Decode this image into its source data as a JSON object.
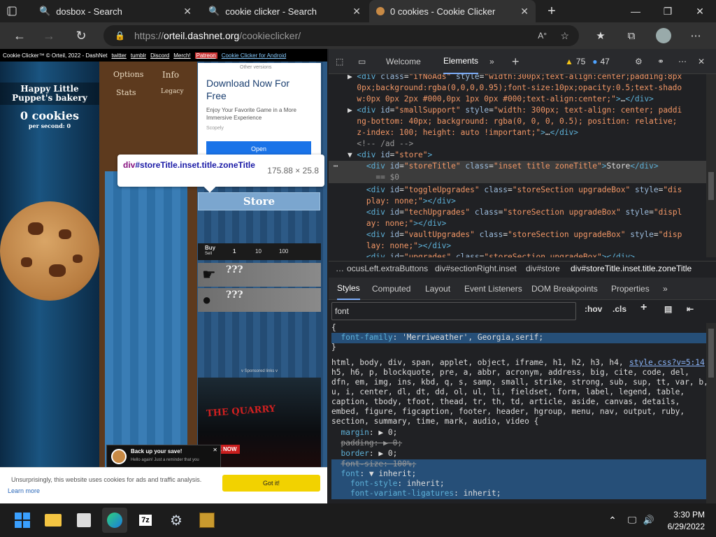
{
  "tabs": [
    {
      "title": "dosbox - Search",
      "icon": "search-icon"
    },
    {
      "title": "cookie clicker - Search",
      "icon": "search-icon"
    },
    {
      "title": "0 cookies - Cookie Clicker",
      "icon": "cookie-icon"
    }
  ],
  "address": {
    "scheme": "https://",
    "host": "orteil.dashnet.org",
    "path": "/cookieclicker/"
  },
  "site": {
    "topbar": [
      "Cookie Clicker™ © Orteil, 2022 - DashNet",
      "twitter",
      "tumblr",
      "Discord",
      "Merch!",
      "Patreon",
      "Cookie Clicker for Android"
    ],
    "bakery_name": "Happy Little Puppet's bakery",
    "cookies": "0 cookies",
    "per_second": "per second: 0",
    "buttons": {
      "options": "Options",
      "info": "Info",
      "stats": "Stats",
      "legacy": "Legacy"
    },
    "ad1": {
      "other": "Other versions",
      "title": "Download Now For Free",
      "desc": "Enjoy Your Favorite Game in a More Immersive Experience",
      "source": "Scopely",
      "open": "Open"
    },
    "tooltip": {
      "selector_tag": "div",
      "selector_rest": "#storeTitle.inset.title.zoneTitle",
      "size": "175.88 × 25.8"
    },
    "store": "Store",
    "buy": {
      "buy": "Buy",
      "sell": "Sell",
      "opts": [
        "1",
        "10",
        "100"
      ]
    },
    "product": "???",
    "sponsored": "v Sponsored links v",
    "ad2": {
      "title": "THE QUARRY",
      "cta": "ABLE NOW"
    },
    "backup": {
      "title": "Back up your save!",
      "text": "Hello again! Just a reminder that you"
    },
    "cookie_notice": {
      "message": "Unsurprisingly, this website uses cookies for ads and traffic analysis.",
      "learn": "Learn more",
      "got": "Got it!"
    }
  },
  "devtools": {
    "tabs": [
      "Welcome",
      "Elements"
    ],
    "warnings": "75",
    "messages": "47",
    "crumbs": [
      "ocusLeft.extraButtons",
      "div#sectionRight.inset",
      "div#store",
      "div#storeTitle.inset.title.zoneTitle"
    ],
    "style_tabs": [
      "Styles",
      "Computed",
      "Layout",
      "Event Listeners",
      "DOM Breakpoints",
      "Properties"
    ],
    "filter": "font",
    "hov": ":hov",
    "cls": ".cls",
    "style_link": "style.css?v=5:14"
  },
  "taskbar": {
    "time": "3:30 PM",
    "date": "6/29/2022"
  }
}
